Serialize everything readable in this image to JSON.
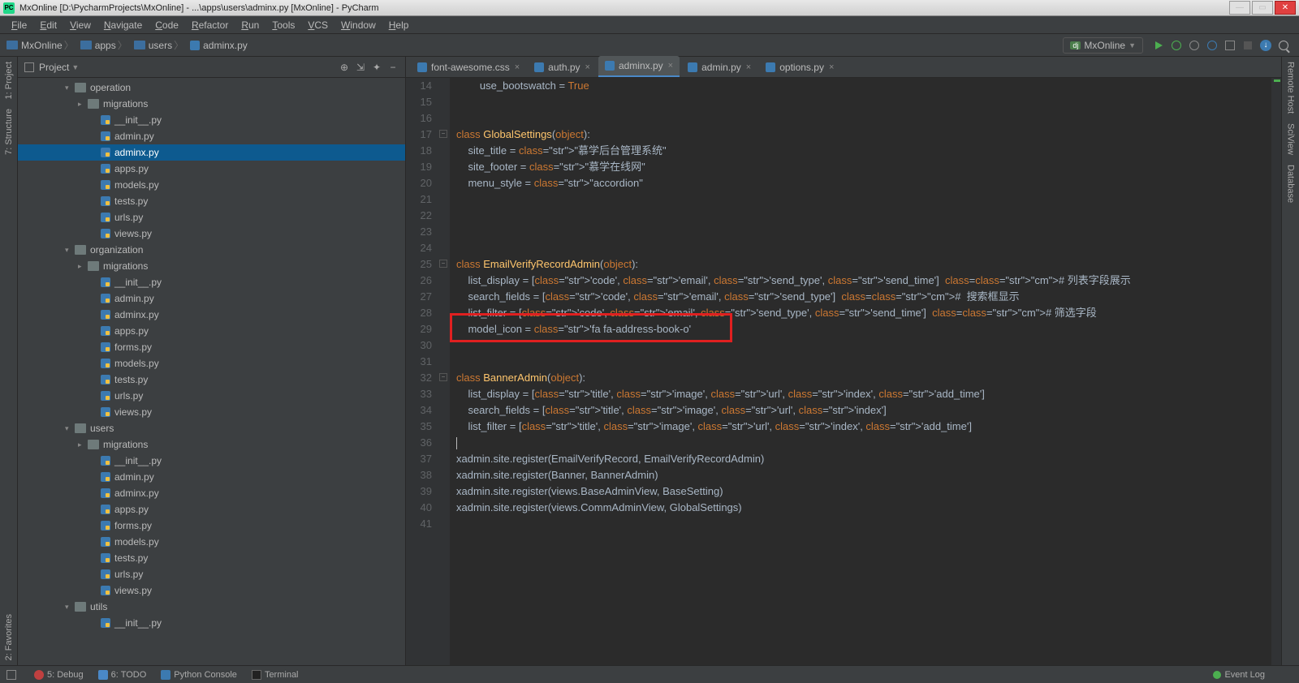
{
  "title": "MxOnline [D:\\PycharmProjects\\MxOnline] - ...\\apps\\users\\adminx.py [MxOnline] - PyCharm",
  "menu": [
    "File",
    "Edit",
    "View",
    "Navigate",
    "Code",
    "Refactor",
    "Run",
    "Tools",
    "VCS",
    "Window",
    "Help"
  ],
  "breadcrumbs": [
    {
      "type": "dir",
      "label": "MxOnline"
    },
    {
      "type": "dir",
      "label": "apps"
    },
    {
      "type": "dir",
      "label": "users"
    },
    {
      "type": "py",
      "label": "adminx.py"
    }
  ],
  "run_config": "MxOnline",
  "project_panel_title": "Project",
  "tree": [
    {
      "ind": 1,
      "arrow": "▾",
      "icon": "folder",
      "name": "operation"
    },
    {
      "ind": 2,
      "arrow": "▸",
      "icon": "folder",
      "name": "migrations"
    },
    {
      "ind": 3,
      "arrow": "",
      "icon": "pyfile",
      "name": "__init__.py"
    },
    {
      "ind": 3,
      "arrow": "",
      "icon": "pyfile",
      "name": "admin.py"
    },
    {
      "ind": 3,
      "arrow": "",
      "icon": "pyfile",
      "name": "adminx.py",
      "sel": true
    },
    {
      "ind": 3,
      "arrow": "",
      "icon": "pyfile",
      "name": "apps.py"
    },
    {
      "ind": 3,
      "arrow": "",
      "icon": "pyfile",
      "name": "models.py"
    },
    {
      "ind": 3,
      "arrow": "",
      "icon": "pyfile",
      "name": "tests.py"
    },
    {
      "ind": 3,
      "arrow": "",
      "icon": "pyfile",
      "name": "urls.py"
    },
    {
      "ind": 3,
      "arrow": "",
      "icon": "pyfile",
      "name": "views.py"
    },
    {
      "ind": 1,
      "arrow": "▾",
      "icon": "folder",
      "name": "organization"
    },
    {
      "ind": 2,
      "arrow": "▸",
      "icon": "folder",
      "name": "migrations"
    },
    {
      "ind": 3,
      "arrow": "",
      "icon": "pyfile",
      "name": "__init__.py"
    },
    {
      "ind": 3,
      "arrow": "",
      "icon": "pyfile",
      "name": "admin.py"
    },
    {
      "ind": 3,
      "arrow": "",
      "icon": "pyfile",
      "name": "adminx.py"
    },
    {
      "ind": 3,
      "arrow": "",
      "icon": "pyfile",
      "name": "apps.py"
    },
    {
      "ind": 3,
      "arrow": "",
      "icon": "pyfile",
      "name": "forms.py"
    },
    {
      "ind": 3,
      "arrow": "",
      "icon": "pyfile",
      "name": "models.py"
    },
    {
      "ind": 3,
      "arrow": "",
      "icon": "pyfile",
      "name": "tests.py"
    },
    {
      "ind": 3,
      "arrow": "",
      "icon": "pyfile",
      "name": "urls.py"
    },
    {
      "ind": 3,
      "arrow": "",
      "icon": "pyfile",
      "name": "views.py"
    },
    {
      "ind": 1,
      "arrow": "▾",
      "icon": "folder",
      "name": "users"
    },
    {
      "ind": 2,
      "arrow": "▸",
      "icon": "folder",
      "name": "migrations"
    },
    {
      "ind": 3,
      "arrow": "",
      "icon": "pyfile",
      "name": "__init__.py"
    },
    {
      "ind": 3,
      "arrow": "",
      "icon": "pyfile",
      "name": "admin.py"
    },
    {
      "ind": 3,
      "arrow": "",
      "icon": "pyfile",
      "name": "adminx.py"
    },
    {
      "ind": 3,
      "arrow": "",
      "icon": "pyfile",
      "name": "apps.py"
    },
    {
      "ind": 3,
      "arrow": "",
      "icon": "pyfile",
      "name": "forms.py"
    },
    {
      "ind": 3,
      "arrow": "",
      "icon": "pyfile",
      "name": "models.py"
    },
    {
      "ind": 3,
      "arrow": "",
      "icon": "pyfile",
      "name": "tests.py"
    },
    {
      "ind": 3,
      "arrow": "",
      "icon": "pyfile",
      "name": "urls.py"
    },
    {
      "ind": 3,
      "arrow": "",
      "icon": "pyfile",
      "name": "views.py"
    },
    {
      "ind": 1,
      "arrow": "▾",
      "icon": "folder",
      "name": "utils"
    },
    {
      "ind": 3,
      "arrow": "",
      "icon": "pyfile",
      "name": "__init__.py"
    }
  ],
  "tabs": [
    {
      "icon": "css",
      "label": "font-awesome.css"
    },
    {
      "icon": "py",
      "label": "auth.py"
    },
    {
      "icon": "py",
      "label": "adminx.py",
      "active": true
    },
    {
      "icon": "py",
      "label": "admin.py"
    },
    {
      "icon": "py",
      "label": "options.py"
    }
  ],
  "line_start": 14,
  "line_end": 41,
  "code_lines": [
    "        use_bootswatch = True",
    "",
    "",
    "class GlobalSettings(object):",
    "    site_title = \"慕学后台管理系统\"",
    "    site_footer = \"慕学在线网\"",
    "    menu_style = \"accordion\"",
    "",
    "",
    "",
    "",
    "class EmailVerifyRecordAdmin(object):",
    "    list_display = ['code', 'email', 'send_type', 'send_time']  # 列表字段展示",
    "    search_fields = ['code', 'email', 'send_type']  #  搜索框显示",
    "    list_filter = ['code', 'email', 'send_type', 'send_time']  # 筛选字段",
    "    model_icon = 'fa fa-address-book-o'",
    "",
    "",
    "class BannerAdmin(object):",
    "    list_display = ['title', 'image', 'url', 'index', 'add_time']",
    "    search_fields = ['title', 'image', 'url', 'index']",
    "    list_filter = ['title', 'image', 'url', 'index', 'add_time']",
    "",
    "xadmin.site.register(EmailVerifyRecord, EmailVerifyRecordAdmin)",
    "xadmin.site.register(Banner, BannerAdmin)",
    "xadmin.site.register(views.BaseAdminView, BaseSetting)",
    "xadmin.site.register(views.CommAdminView, GlobalSettings)",
    ""
  ],
  "redbox": {
    "line": 29,
    "content": "model_icon = 'fa fa-address-book-o'"
  },
  "left_strip": [
    "1: Project",
    "7: Structure"
  ],
  "right_strip": [
    "Remote Host",
    "SciView",
    "Database"
  ],
  "left_strip_bottom": "2: Favorites",
  "status": {
    "debug": "5: Debug",
    "todo": "6: TODO",
    "pyconsole": "Python Console",
    "terminal": "Terminal",
    "eventlog": "Event Log"
  }
}
